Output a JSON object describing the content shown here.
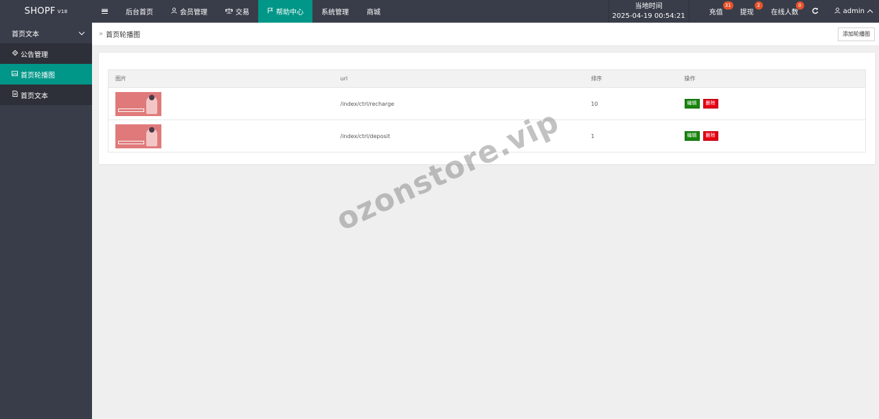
{
  "logo": {
    "name": "SHOPF",
    "version": "V18"
  },
  "topnav": {
    "items": [
      {
        "label": "后台首页",
        "icon": "none"
      },
      {
        "label": "会员管理",
        "icon": "user-icon"
      },
      {
        "label": "交易",
        "icon": "scale-icon"
      },
      {
        "label": "帮助中心",
        "icon": "flag-icon",
        "active": true
      },
      {
        "label": "系统管理",
        "icon": "none"
      },
      {
        "label": "商城",
        "icon": "none"
      }
    ]
  },
  "clock": {
    "label": "当地时间",
    "value": "2025-04-19 00:54:21"
  },
  "right_items": {
    "recharge": {
      "label": "充值",
      "badge": "31"
    },
    "withdraw": {
      "label": "提现",
      "badge": "2"
    },
    "online": {
      "label": "在线人数",
      "badge": "0"
    }
  },
  "user": {
    "name": "admin"
  },
  "sidebar": {
    "group_label": "首页文本",
    "items": [
      {
        "label": "公告管理",
        "icon": "diamond-icon"
      },
      {
        "label": "首页轮播图",
        "icon": "image-icon",
        "active": true
      },
      {
        "label": "首页文本",
        "icon": "document-icon"
      }
    ]
  },
  "breadcrumb": {
    "current": "首页轮播图"
  },
  "add_button": "添加轮播图",
  "table": {
    "headers": [
      "图片",
      "url",
      "排序",
      "操作"
    ],
    "rows": [
      {
        "url": "/index/ctrl/recharge",
        "order": "10"
      },
      {
        "url": "/index/ctrl/deposit",
        "order": "1"
      }
    ],
    "edit_label": "编辑",
    "delete_label": "删除"
  },
  "watermark": "ozonstore.vip",
  "colors": {
    "topbar": "#393d49",
    "accent": "#009688",
    "edit": "#18850e",
    "delete": "#e60012",
    "badge": "#e6522b"
  }
}
